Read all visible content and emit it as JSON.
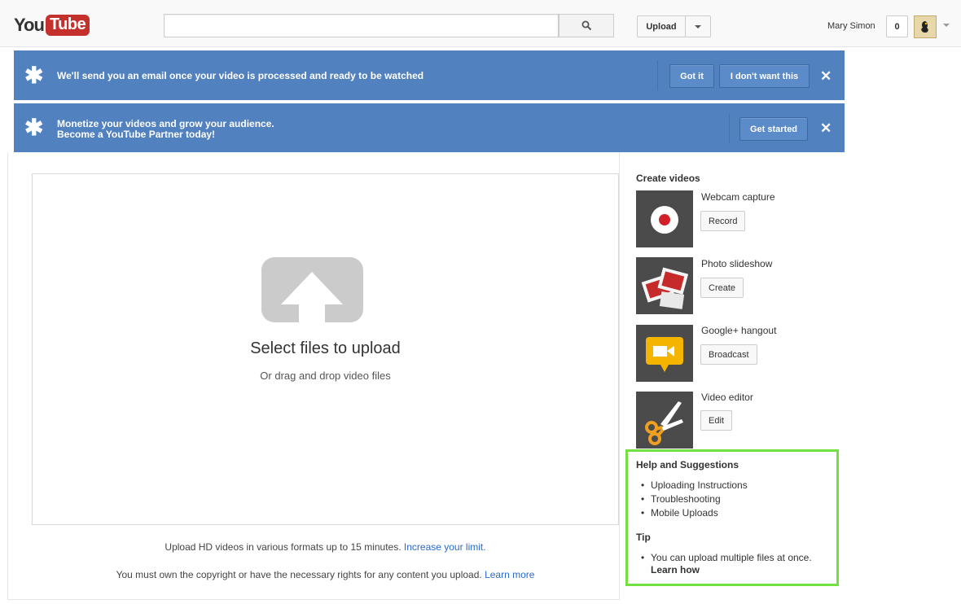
{
  "header": {
    "logo_you": "You",
    "logo_tube": "Tube",
    "search_placeholder": "",
    "upload_label": "Upload",
    "user_name": "Mary Simon",
    "notification_count": "0"
  },
  "banners": [
    {
      "text_line1": "We'll send you an email once your video is processed and ready to be watched",
      "text_line2": "",
      "buttons": [
        "Got it",
        "I don't want this"
      ],
      "close": "✕"
    },
    {
      "text_line1": "Monetize your videos and grow your audience.",
      "text_line2": "Become a YouTube Partner today!",
      "buttons": [
        "Get started"
      ],
      "close": "✕"
    }
  ],
  "upload": {
    "title": "Select files to upload",
    "subtitle": "Or drag and drop video files",
    "note1_text": "Upload HD videos in various formats up to 15 minutes.",
    "note1_link": "Increase your limit.",
    "note2_text": "You must own the copyright or have the necessary rights for any content you upload.",
    "note2_link": "Learn more"
  },
  "create": {
    "title": "Create videos",
    "items": [
      {
        "label": "Webcam capture",
        "button": "Record",
        "icon": "record-icon"
      },
      {
        "label": "Photo slideshow",
        "button": "Create",
        "icon": "photos-icon"
      },
      {
        "label": "Google+ hangout",
        "button": "Broadcast",
        "icon": "hangout-icon"
      },
      {
        "label": "Video editor",
        "button": "Edit",
        "icon": "scissors-icon"
      }
    ]
  },
  "help": {
    "title": "Help and Suggestions",
    "links": [
      "Uploading Instructions",
      "Troubleshooting",
      "Mobile Uploads"
    ],
    "tip_title": "Tip",
    "tip_text": "You can upload multiple files at once.",
    "tip_link": "Learn how"
  },
  "colors": {
    "banner": "#5281bf",
    "logo_red": "#c4302b",
    "highlight": "#72e040",
    "link": "#2a6ac8"
  }
}
